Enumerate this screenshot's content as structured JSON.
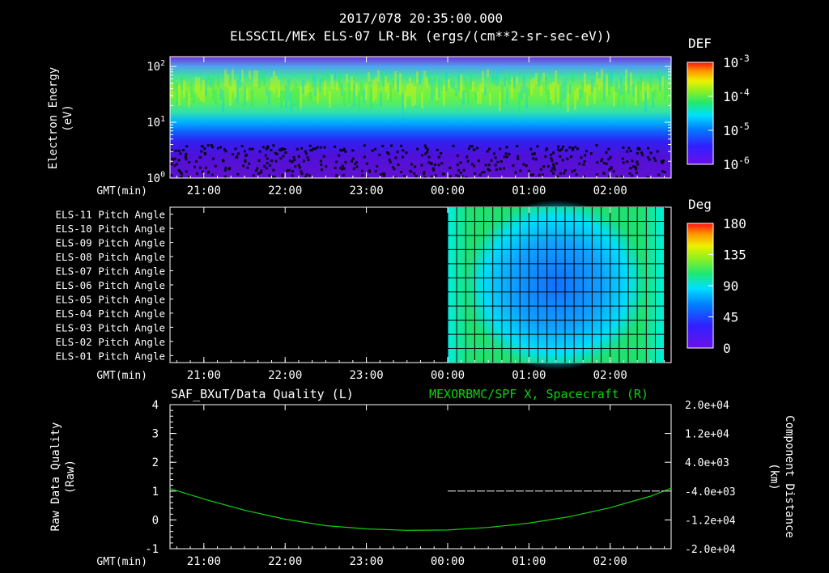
{
  "header": {
    "timestamp": "2017/078 20:35:00.000",
    "title": "ELSSCIL/MEx ELS-07 LR-Bk  (ergs/(cm**2-sr-sec-eV))"
  },
  "time_axis": {
    "prefix": "GMT(min)",
    "ticks": [
      "21:00",
      "22:00",
      "23:00",
      "00:00",
      "01:00",
      "02:00"
    ]
  },
  "chart_data": [
    {
      "type": "heatmap",
      "id": "energy-spectrogram",
      "ylabel_line1": "Electron Energy",
      "ylabel_line2": "(eV)",
      "y_scale": "log",
      "ylim": [
        1,
        150
      ],
      "y_tick_labels": [
        {
          "value": 1,
          "base": "10",
          "exp": "0"
        },
        {
          "value": 10,
          "base": "10",
          "exp": "1"
        },
        {
          "value": 100,
          "base": "10",
          "exp": "2"
        }
      ],
      "colorbar": {
        "label": "DEF",
        "scale": "log",
        "range": [
          1e-06,
          0.001
        ],
        "tick_labels": [
          {
            "value": 0.001,
            "base": "10",
            "exp": "-3"
          },
          {
            "value": 0.0001,
            "base": "10",
            "exp": "-4"
          },
          {
            "value": 1e-05,
            "base": "10",
            "exp": "-5"
          },
          {
            "value": 1e-06,
            "base": "10",
            "exp": "-6"
          }
        ]
      },
      "colors": {
        "low": "#5010d0",
        "mid": "#00e0ff",
        "high": "#ff2020"
      }
    },
    {
      "type": "heatmap",
      "id": "pitch-angle",
      "rows": [
        "ELS-11 Pitch Angle",
        "ELS-10 Pitch Angle",
        "ELS-09 Pitch Angle",
        "ELS-08 Pitch Angle",
        "ELS-07 Pitch Angle",
        "ELS-06 Pitch Angle",
        "ELS-05 Pitch Angle",
        "ELS-04 Pitch Angle",
        "ELS-03 Pitch Angle",
        "ELS-02 Pitch Angle",
        "ELS-01 Pitch Angle"
      ],
      "data_start": "00:00",
      "data_end": "02:40",
      "colorbar": {
        "label": "Deg",
        "range": [
          0,
          180
        ],
        "tick_labels": [
          "180",
          "135",
          "90",
          "45",
          "0"
        ]
      }
    },
    {
      "type": "line",
      "id": "quality-and-position",
      "title_left": "SAF_BXuT/Data Quality (L)",
      "title_right": "MEXORBMC/SPF X, Spacecraft (R)",
      "ylabel_left_line1": "Raw Data Quality",
      "ylabel_left_line2": "(Raw)",
      "ylabel_right_line1": "Component Distance",
      "ylabel_right_line2": "(km)",
      "ylim_left": [
        -1,
        4
      ],
      "left_tick_labels": [
        "4",
        "3",
        "2",
        "1",
        "0",
        "-1"
      ],
      "ylim_right": [
        -20000,
        20000
      ],
      "right_tick_labels": [
        "2.0e+04",
        "1.2e+04",
        "4.0e+03",
        "-4.0e+03",
        "-1.2e+04",
        "-2.0e+04"
      ],
      "x_minutes_from_21": [
        -25,
        0,
        30,
        60,
        90,
        120,
        150,
        180,
        210,
        240,
        270,
        300,
        330,
        345
      ],
      "spf_x_km": [
        -3300,
        -6200,
        -9300,
        -11800,
        -13600,
        -14500,
        -14900,
        -14800,
        -14100,
        -12900,
        -11100,
        -8600,
        -5400,
        -3200
      ],
      "quality_segment": {
        "start_min": 180,
        "end_min": 340,
        "value": 1
      },
      "colors": {
        "spf_x": "#10d010",
        "quality": "#ffffff"
      }
    }
  ]
}
